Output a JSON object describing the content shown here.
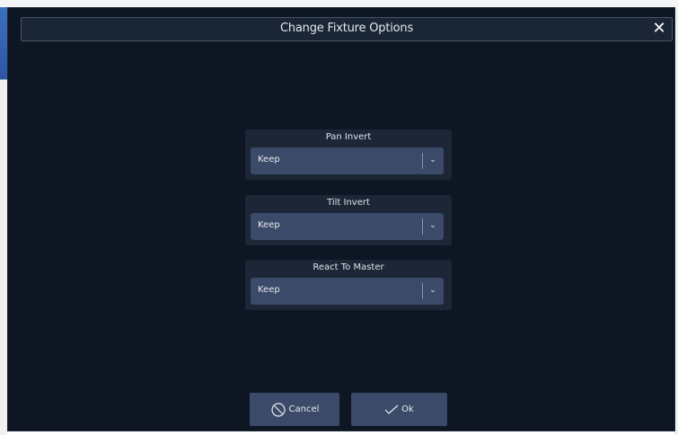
{
  "dialog": {
    "title": "Change Fixture Options",
    "close_icon": "close-icon"
  },
  "options": [
    {
      "label": "Pan Invert",
      "value": "Keep"
    },
    {
      "label": "Tilt Invert",
      "value": "Keep"
    },
    {
      "label": "React To Master",
      "value": "Keep"
    }
  ],
  "buttons": {
    "cancel_label": "Cancel",
    "ok_label": "Ok",
    "cancel_icon": "cancel-circle-icon",
    "ok_icon": "checkmark-icon"
  },
  "colors": {
    "dialog_background": "#0e1624",
    "panel_background": "#1c2636",
    "control_background": "#3a4a68",
    "text": "#e8ebf0"
  }
}
